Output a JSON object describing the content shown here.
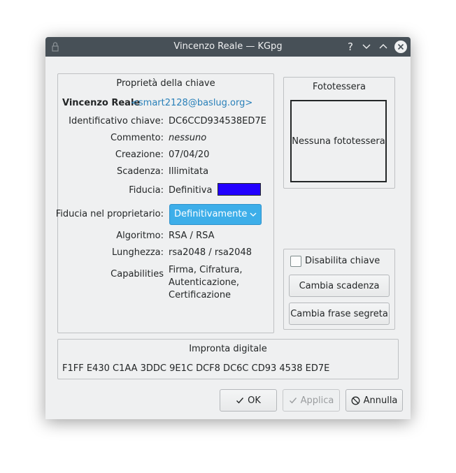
{
  "window": {
    "title": "Vincenzo Reale — KGpg",
    "help_glyph": "?"
  },
  "props": {
    "title": "Proprietà della chiave",
    "owner_name": "Vincenzo Reale",
    "owner_email": "<smart2128@baslug.org>",
    "key_id_label": "Identificativo chiave:",
    "key_id": "DC6CCD934538ED7E",
    "comment_label": "Commento:",
    "comment": "nessuno",
    "creation_label": "Creazione:",
    "creation": "07/04/20",
    "expiry_label": "Scadenza:",
    "expiry": "Illimitata",
    "trust_label": "Fiducia:",
    "trust": "Definitiva",
    "trust_color": "#2200ff",
    "owner_trust_label": "Fiducia nel proprietario:",
    "owner_trust": "Definitivamente",
    "algorithm_label": "Algoritmo:",
    "algorithm": "RSA / RSA",
    "length_label": "Lunghezza:",
    "length": "rsa2048 / rsa2048",
    "capabilities_label": "Capabilities",
    "capabilities": [
      "Firma, Cifratura,",
      "Autenticazione,",
      "Certificazione"
    ]
  },
  "photo": {
    "title": "Fototessera",
    "empty_text": "Nessuna fototessera"
  },
  "actions": {
    "disable_label": "Disabilita chiave",
    "disable_checked": false,
    "change_expiry": "Cambia scadenza",
    "change_pass": "Cambia frase segreta"
  },
  "fingerprint": {
    "title": "Impronta digitale",
    "value": "F1FF E430 C1AA 3DDC 9E1C DCF8 DC6C CD93 4538 ED7E"
  },
  "buttons": {
    "ok": "OK",
    "apply": "Applica",
    "cancel": "Annulla"
  },
  "colors": {
    "titlebar": "#475057",
    "accent": "#3daee9",
    "link": "#2980b9"
  }
}
